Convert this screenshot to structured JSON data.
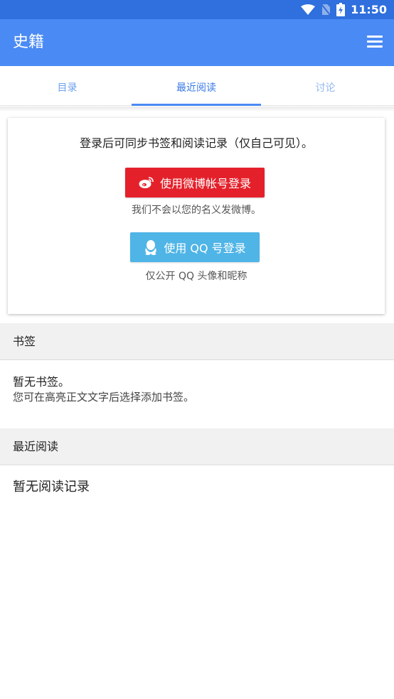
{
  "status_bar": {
    "time": "11:50",
    "icons": [
      "wifi-icon",
      "no-sim-icon",
      "battery-charging-icon"
    ],
    "color": "#2f6fde"
  },
  "app_bar": {
    "title": "史籍",
    "menu_icon": "hamburger-menu-icon",
    "color": "#4a8af4"
  },
  "tabs": [
    {
      "label": "目录"
    },
    {
      "label": "最近阅读",
      "active": true
    },
    {
      "label": "讨论"
    }
  ],
  "login": {
    "prompt": "登录后可同步书签和阅读记录（仅自己可见）。",
    "weibo_button": "使用微博帐号登录",
    "weibo_note": "我们不会以您的名义发微博。",
    "weibo_color": "#e4212b",
    "qq_button": "使用 QQ 号登录",
    "qq_note": "仅公开 QQ 头像和昵称",
    "qq_color": "#4fb4e6"
  },
  "bookmarks": {
    "header": "书签",
    "empty": "暂无书签。",
    "hint": "您可在高亮正文文字后选择添加书签。"
  },
  "recent_reading": {
    "header": "最近阅读",
    "empty": "暂无阅读记录"
  }
}
